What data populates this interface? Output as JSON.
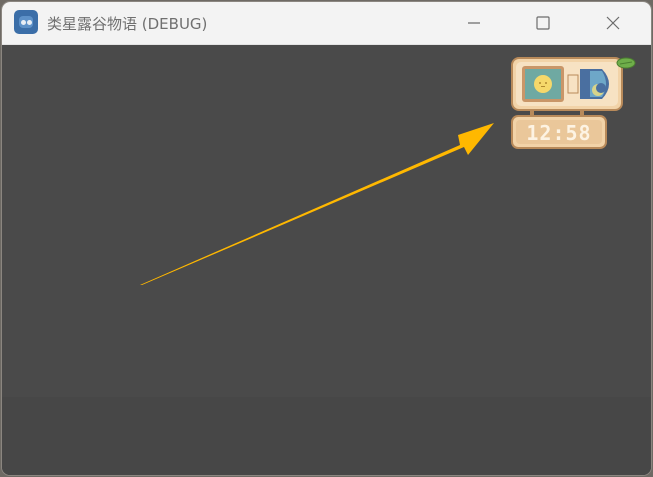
{
  "window": {
    "title": "类星露谷物语 (DEBUG)",
    "app_icon": "godot-robot-icon"
  },
  "controls": {
    "minimize_icon": "minimize-icon",
    "maximize_icon": "maximize-icon",
    "close_icon": "close-icon"
  },
  "hud": {
    "clock_time": "12:58",
    "day_icon": "sun-icon",
    "night_icon": "moon-icon",
    "season_icon": "leaf-icon"
  },
  "annotation": {
    "arrow_color": "#ffb800"
  },
  "colors": {
    "background": "#4a4a4a",
    "titlebar": "#f3f3f3",
    "widget_frame": "#f2d3a8",
    "widget_border": "#b88a5a"
  }
}
